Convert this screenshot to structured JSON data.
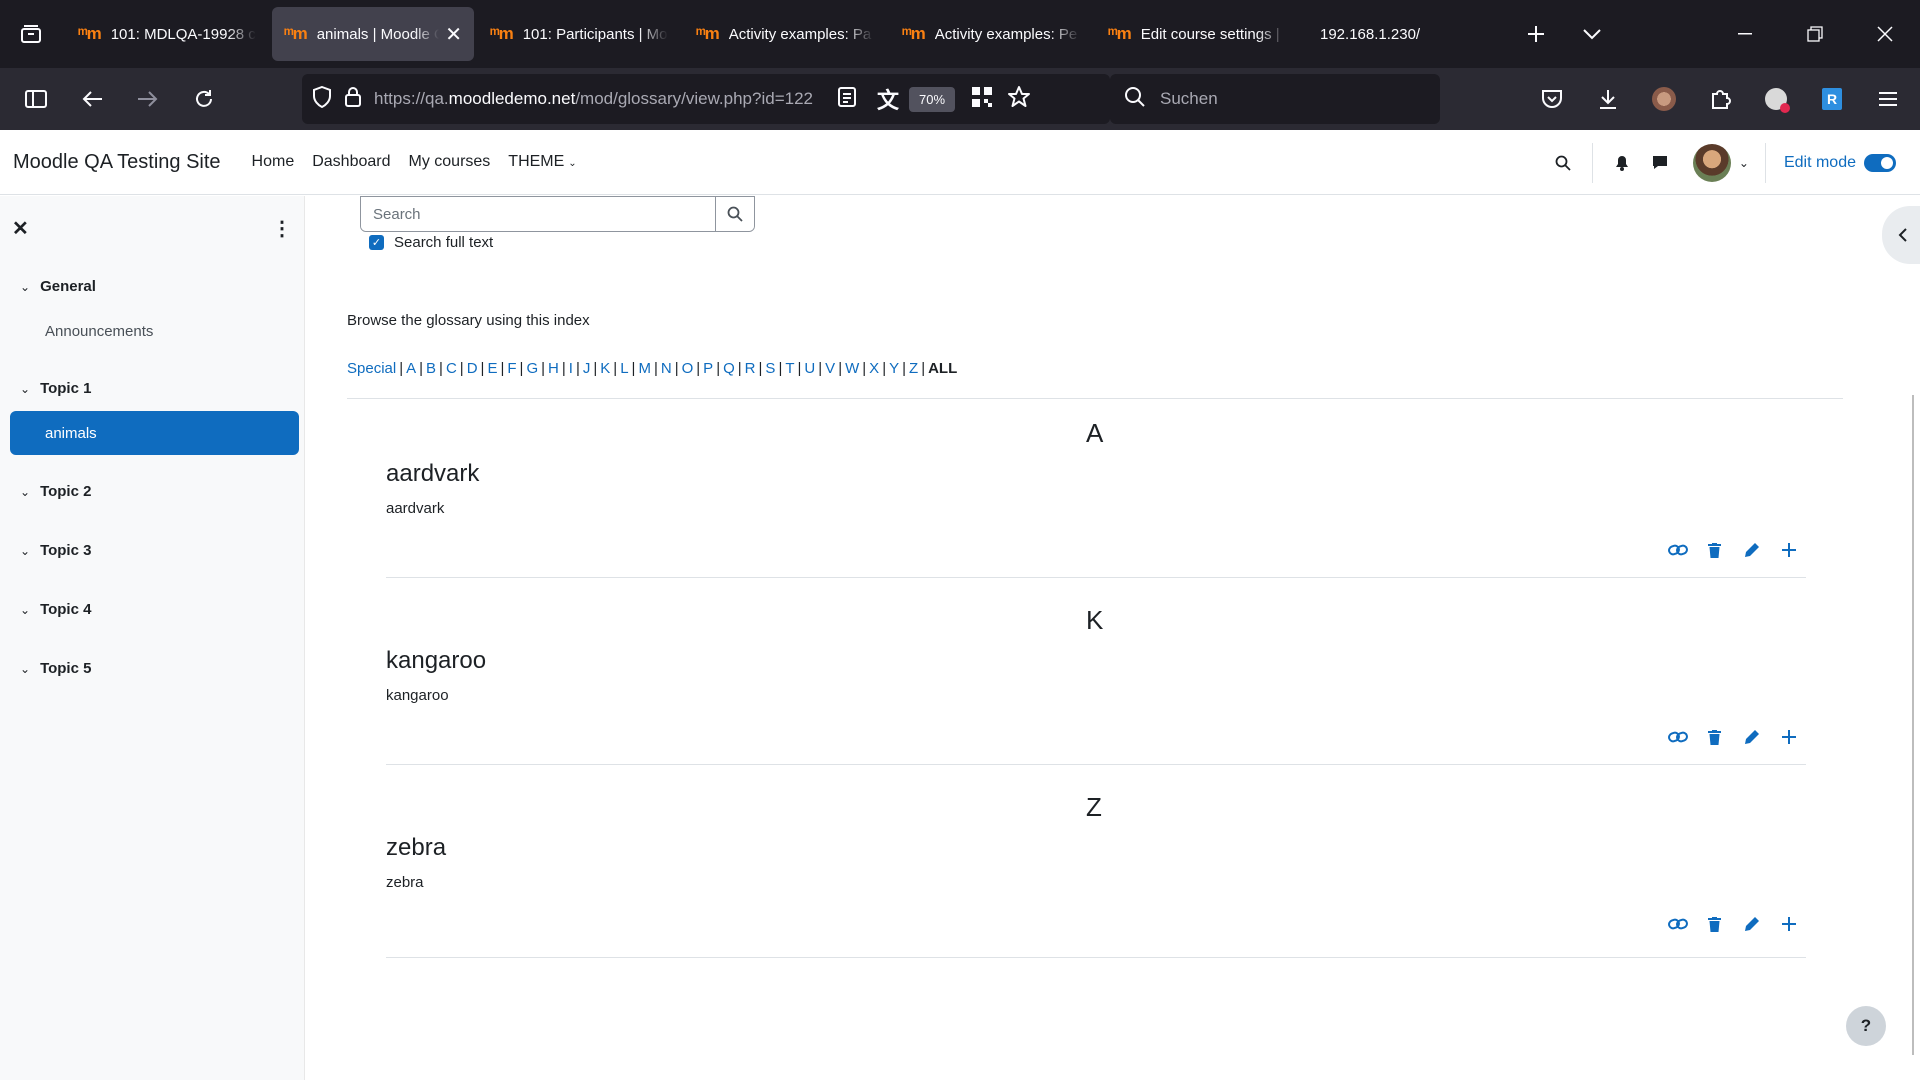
{
  "browser": {
    "tabs": [
      {
        "title": "101: MDLQA-19928 c",
        "favicon": "m",
        "active": false
      },
      {
        "title": "animals | Moodle QA",
        "favicon": "m",
        "active": true
      },
      {
        "title": "101: Participants | Mo",
        "favicon": "m",
        "active": false
      },
      {
        "title": "Activity examples: Pa",
        "favicon": "m",
        "active": false
      },
      {
        "title": "Activity examples: Pe",
        "favicon": "m",
        "active": false
      },
      {
        "title": "Edit course settings |",
        "favicon": "m",
        "active": false
      },
      {
        "title": "192.168.1.230/",
        "favicon": "",
        "active": false
      }
    ],
    "url_host_prefix": "https://qa.",
    "url_host": "moodledemo.net",
    "url_path": "/mod/glossary/view.php?id=122",
    "zoom": "70%",
    "search_placeholder": "Suchen"
  },
  "header": {
    "site_name": "Moodle QA Testing Site",
    "nav": [
      "Home",
      "Dashboard",
      "My courses",
      "THEME"
    ],
    "edit_mode_label": "Edit mode",
    "edit_mode_on": true
  },
  "course_index": {
    "sections": [
      {
        "title": "General",
        "activities": [
          "Announcements"
        ]
      },
      {
        "title": "Topic 1",
        "activities": [
          "animals"
        ]
      },
      {
        "title": "Topic 2",
        "activities": []
      },
      {
        "title": "Topic 3",
        "activities": []
      },
      {
        "title": "Topic 4",
        "activities": []
      },
      {
        "title": "Topic 5",
        "activities": []
      }
    ],
    "active_activity": "animals"
  },
  "glossary": {
    "search_placeholder": "Search",
    "search_full_text_label": "Search full text",
    "search_full_text_checked": true,
    "browse_label": "Browse the glossary using this index",
    "index": [
      "Special",
      "A",
      "B",
      "C",
      "D",
      "E",
      "F",
      "G",
      "H",
      "I",
      "J",
      "K",
      "L",
      "M",
      "N",
      "O",
      "P",
      "Q",
      "R",
      "S",
      "T",
      "U",
      "V",
      "W",
      "X",
      "Y",
      "Z"
    ],
    "index_all": "ALL",
    "entries": [
      {
        "letter": "A",
        "concept": "aardvark",
        "definition": "aardvark"
      },
      {
        "letter": "K",
        "concept": "kangaroo",
        "definition": "kangaroo"
      },
      {
        "letter": "Z",
        "concept": "zebra",
        "definition": "zebra"
      }
    ]
  },
  "help_label": "?",
  "colors": {
    "primary": "#0f6cbf",
    "browser_dark": "#1c1b22"
  }
}
